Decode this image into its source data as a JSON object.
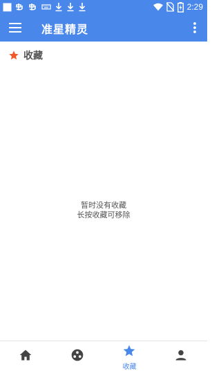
{
  "status_bar": {
    "time": "2:29",
    "icons": [
      "notification-square-icon",
      "chat-app-icon",
      "chat-app-icon",
      "keyboard-icon",
      "download-icon",
      "download-icon",
      "download-icon",
      "wifi-icon",
      "no-sim-icon",
      "battery-charging-icon"
    ]
  },
  "app_bar": {
    "title": "准星精灵"
  },
  "section": {
    "title": "收藏"
  },
  "empty_state": {
    "line1": "暂时没有收藏",
    "line2": "长按收藏可移除"
  },
  "bottom_nav": {
    "items": [
      {
        "icon": "home-icon",
        "label": ""
      },
      {
        "icon": "crosshair-dots-icon",
        "label": ""
      },
      {
        "icon": "star-icon",
        "label": "收藏",
        "active": true
      },
      {
        "icon": "person-icon",
        "label": ""
      }
    ]
  },
  "colors": {
    "primary": "#4a87ea",
    "star": "#f05a28",
    "nav_icon": "#444444",
    "text": "#555555"
  }
}
